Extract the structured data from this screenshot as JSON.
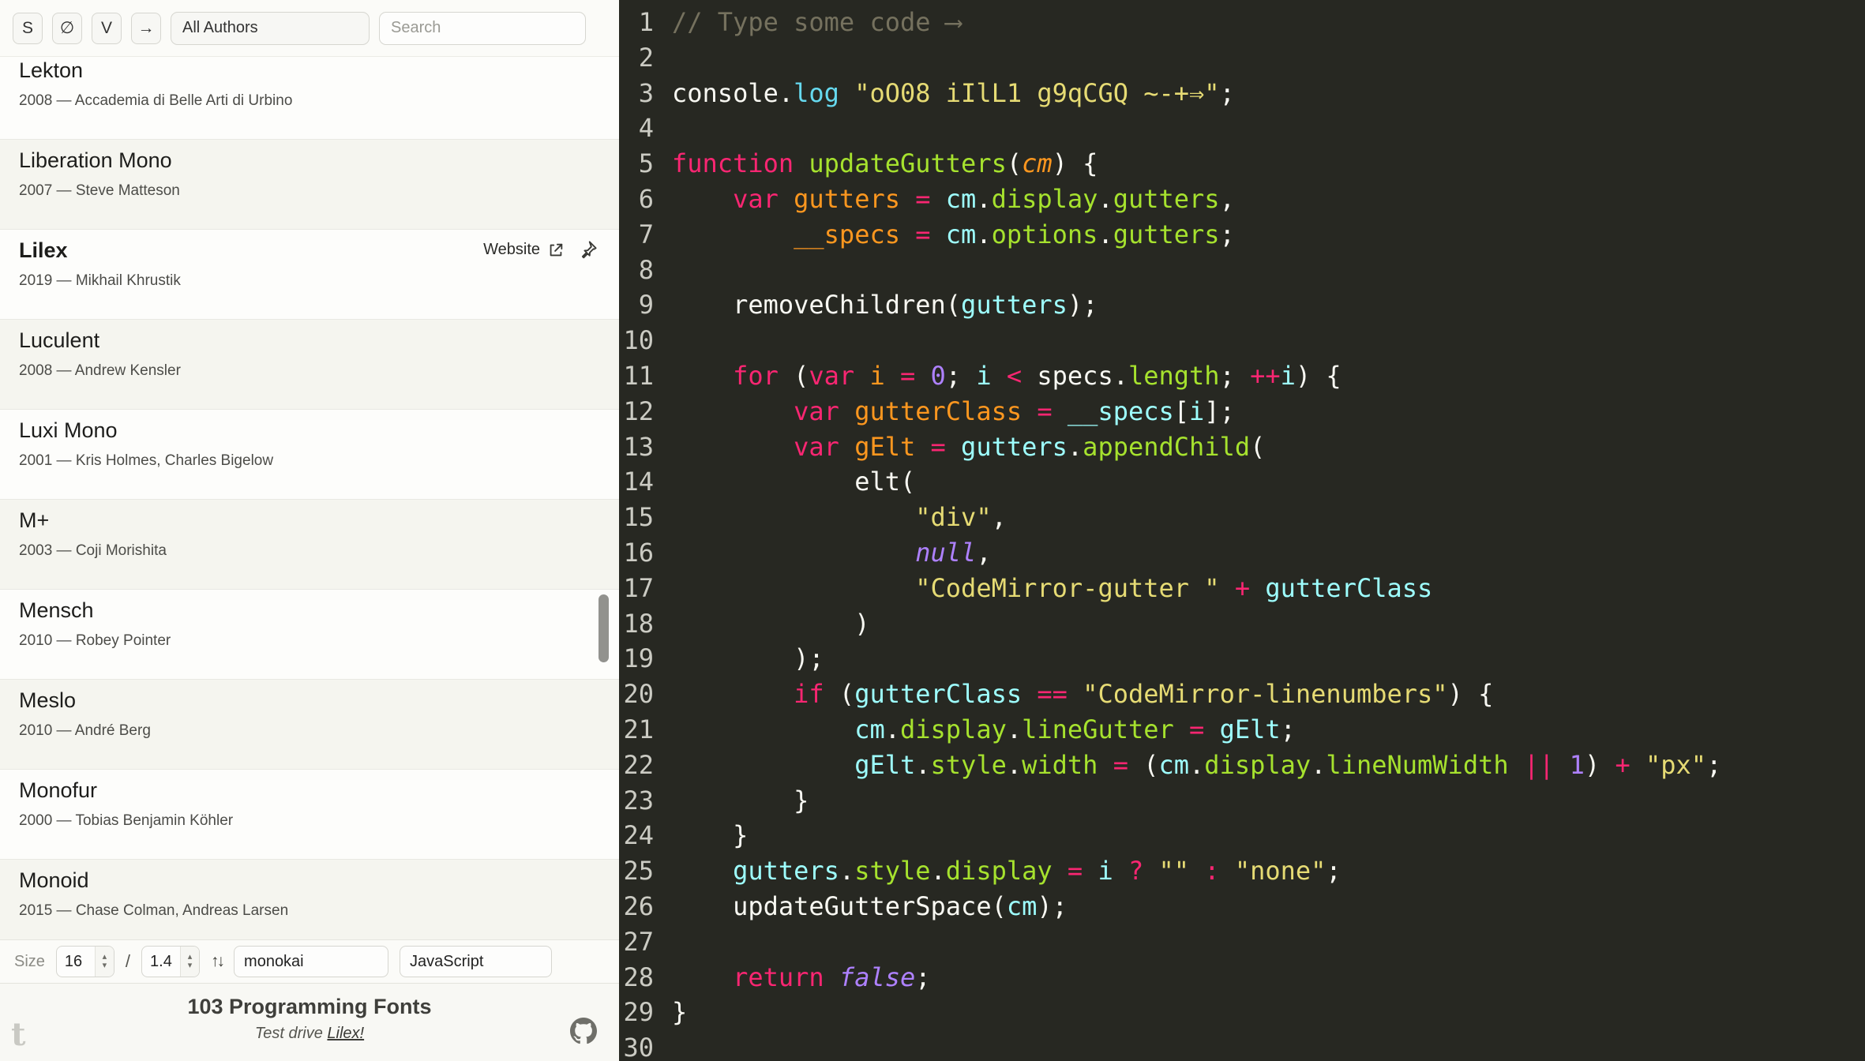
{
  "sidebar": {
    "toolbar": {
      "style_toggles": [
        "S",
        "∅",
        "V",
        "→"
      ],
      "author_filter_value": "All Authors",
      "search_placeholder": "Search"
    },
    "fonts": [
      {
        "name": "Lekton",
        "year": "2008",
        "author": "Accademia di Belle Arti di Urbino"
      },
      {
        "name": "Liberation Mono",
        "year": "2007",
        "author": "Steve Matteson"
      },
      {
        "name": "Lilex",
        "year": "2019",
        "author": "Mikhail Khrustik",
        "selected": true,
        "website_label": "Website"
      },
      {
        "name": "Luculent",
        "year": "2008",
        "author": "Andrew Kensler"
      },
      {
        "name": "Luxi Mono",
        "year": "2001",
        "author": "Kris Holmes, Charles Bigelow"
      },
      {
        "name": "M+",
        "year": "2003",
        "author": "Coji Morishita"
      },
      {
        "name": "Mensch",
        "year": "2010",
        "author": "Robey Pointer"
      },
      {
        "name": "Meslo",
        "year": "2010",
        "author": "André Berg"
      },
      {
        "name": "Monofur",
        "year": "2000",
        "author": "Tobias Benjamin Köhler"
      },
      {
        "name": "Monoid",
        "year": "2015",
        "author": "Chase Colman, Andreas Larsen"
      }
    ],
    "controls": {
      "size_label": "Size",
      "size_value": "16",
      "separator": "/",
      "line_height_value": "1.4",
      "sort_icon": "↑↓",
      "theme_value": "monokai",
      "language_value": "JavaScript"
    },
    "footer": {
      "count_title": "103 Programming Fonts",
      "tagline_prefix": "Test drive ",
      "tagline_link": "Lilex!",
      "t_logo": "t"
    },
    "ui_colors": {
      "stripe": "#f5f5ef",
      "border": "#e9e9e3",
      "background": "#fdfdfb"
    }
  },
  "editor": {
    "palette": {
      "background": "#272822",
      "lineNumber": "#cbcbc3",
      "w": "#f8f8f2",
      "k": "#f92672",
      "s": "#e6db74",
      "c": "#75715e",
      "n": "#ae81ff",
      "ni": "#ae81ff",
      "d": "#fd971f",
      "di": "#fd971f",
      "g": "#a6e22e",
      "b": "#66d9ef",
      "v2": "#9effff"
    },
    "lines": [
      [
        [
          "// Type some code ⟶",
          "c"
        ]
      ],
      [],
      [
        [
          "console",
          "w"
        ],
        [
          ".",
          "w"
        ],
        [
          "log",
          "b"
        ],
        [
          " ",
          "w"
        ],
        [
          "\"oO08 iIlL1 g9qCGQ ~-+⇒\"",
          "s"
        ],
        [
          ";",
          "w"
        ]
      ],
      [],
      [
        [
          "function",
          "k"
        ],
        [
          " ",
          "w"
        ],
        [
          "updateGutters",
          "g"
        ],
        [
          "(",
          "w"
        ],
        [
          "cm",
          "di"
        ],
        [
          ") {",
          "w"
        ]
      ],
      [
        [
          "    ",
          "w"
        ],
        [
          "var",
          "k"
        ],
        [
          " ",
          "w"
        ],
        [
          "gutters",
          "d"
        ],
        [
          " ",
          "w"
        ],
        [
          "=",
          "k"
        ],
        [
          " ",
          "w"
        ],
        [
          "cm",
          "v2"
        ],
        [
          ".",
          "w"
        ],
        [
          "display",
          "g"
        ],
        [
          ".",
          "w"
        ],
        [
          "gutters",
          "g"
        ],
        [
          ",",
          "w"
        ]
      ],
      [
        [
          "        ",
          "w"
        ],
        [
          "__specs",
          "d"
        ],
        [
          " ",
          "w"
        ],
        [
          "=",
          "k"
        ],
        [
          " ",
          "w"
        ],
        [
          "cm",
          "v2"
        ],
        [
          ".",
          "w"
        ],
        [
          "options",
          "g"
        ],
        [
          ".",
          "w"
        ],
        [
          "gutters",
          "g"
        ],
        [
          ";",
          "w"
        ]
      ],
      [],
      [
        [
          "    ",
          "w"
        ],
        [
          "removeChildren",
          "w"
        ],
        [
          "(",
          "w"
        ],
        [
          "gutters",
          "v2"
        ],
        [
          ");",
          "w"
        ]
      ],
      [],
      [
        [
          "    ",
          "w"
        ],
        [
          "for",
          "k"
        ],
        [
          " (",
          "w"
        ],
        [
          "var",
          "k"
        ],
        [
          " ",
          "w"
        ],
        [
          "i",
          "d"
        ],
        [
          " ",
          "w"
        ],
        [
          "=",
          "k"
        ],
        [
          " ",
          "w"
        ],
        [
          "0",
          "n"
        ],
        [
          "; ",
          "w"
        ],
        [
          "i",
          "v2"
        ],
        [
          " ",
          "w"
        ],
        [
          "<",
          "k"
        ],
        [
          " ",
          "w"
        ],
        [
          "specs",
          "w"
        ],
        [
          ".",
          "w"
        ],
        [
          "length",
          "g"
        ],
        [
          "; ",
          "w"
        ],
        [
          "++",
          "k"
        ],
        [
          "i",
          "v2"
        ],
        [
          ") {",
          "w"
        ]
      ],
      [
        [
          "        ",
          "w"
        ],
        [
          "var",
          "k"
        ],
        [
          " ",
          "w"
        ],
        [
          "gutterClass",
          "d"
        ],
        [
          " ",
          "w"
        ],
        [
          "=",
          "k"
        ],
        [
          " ",
          "w"
        ],
        [
          "__specs",
          "v2"
        ],
        [
          "[",
          "w"
        ],
        [
          "i",
          "v2"
        ],
        [
          "];",
          "w"
        ]
      ],
      [
        [
          "        ",
          "w"
        ],
        [
          "var",
          "k"
        ],
        [
          " ",
          "w"
        ],
        [
          "gElt",
          "d"
        ],
        [
          " ",
          "w"
        ],
        [
          "=",
          "k"
        ],
        [
          " ",
          "w"
        ],
        [
          "gutters",
          "v2"
        ],
        [
          ".",
          "w"
        ],
        [
          "appendChild",
          "g"
        ],
        [
          "(",
          "w"
        ]
      ],
      [
        [
          "            ",
          "w"
        ],
        [
          "elt",
          "w"
        ],
        [
          "(",
          "w"
        ]
      ],
      [
        [
          "                ",
          "w"
        ],
        [
          "\"div\"",
          "s"
        ],
        [
          ",",
          "w"
        ]
      ],
      [
        [
          "                ",
          "w"
        ],
        [
          "null",
          "ni"
        ],
        [
          ",",
          "w"
        ]
      ],
      [
        [
          "                ",
          "w"
        ],
        [
          "\"CodeMirror-gutter \"",
          "s"
        ],
        [
          " ",
          "w"
        ],
        [
          "+",
          "k"
        ],
        [
          " ",
          "w"
        ],
        [
          "gutterClass",
          "v2"
        ]
      ],
      [
        [
          "            )",
          "w"
        ]
      ],
      [
        [
          "        );",
          "w"
        ]
      ],
      [
        [
          "        ",
          "w"
        ],
        [
          "if",
          "k"
        ],
        [
          " (",
          "w"
        ],
        [
          "gutterClass",
          "v2"
        ],
        [
          " ",
          "w"
        ],
        [
          "==",
          "k"
        ],
        [
          " ",
          "w"
        ],
        [
          "\"CodeMirror-linenumbers\"",
          "s"
        ],
        [
          ") {",
          "w"
        ]
      ],
      [
        [
          "            ",
          "w"
        ],
        [
          "cm",
          "v2"
        ],
        [
          ".",
          "w"
        ],
        [
          "display",
          "g"
        ],
        [
          ".",
          "w"
        ],
        [
          "lineGutter",
          "g"
        ],
        [
          " ",
          "w"
        ],
        [
          "=",
          "k"
        ],
        [
          " ",
          "w"
        ],
        [
          "gElt",
          "v2"
        ],
        [
          ";",
          "w"
        ]
      ],
      [
        [
          "            ",
          "w"
        ],
        [
          "gElt",
          "v2"
        ],
        [
          ".",
          "w"
        ],
        [
          "style",
          "g"
        ],
        [
          ".",
          "w"
        ],
        [
          "width",
          "g"
        ],
        [
          " ",
          "w"
        ],
        [
          "=",
          "k"
        ],
        [
          " (",
          "w"
        ],
        [
          "cm",
          "v2"
        ],
        [
          ".",
          "w"
        ],
        [
          "display",
          "g"
        ],
        [
          ".",
          "w"
        ],
        [
          "lineNumWidth",
          "g"
        ],
        [
          " ",
          "w"
        ],
        [
          "||",
          "k"
        ],
        [
          " ",
          "w"
        ],
        [
          "1",
          "n"
        ],
        [
          ") ",
          "w"
        ],
        [
          "+",
          "k"
        ],
        [
          " ",
          "w"
        ],
        [
          "\"px\"",
          "s"
        ],
        [
          ";",
          "w"
        ]
      ],
      [
        [
          "        }",
          "w"
        ]
      ],
      [
        [
          "    }",
          "w"
        ]
      ],
      [
        [
          "    ",
          "w"
        ],
        [
          "gutters",
          "v2"
        ],
        [
          ".",
          "w"
        ],
        [
          "style",
          "g"
        ],
        [
          ".",
          "w"
        ],
        [
          "display",
          "g"
        ],
        [
          " ",
          "w"
        ],
        [
          "=",
          "k"
        ],
        [
          " ",
          "w"
        ],
        [
          "i",
          "v2"
        ],
        [
          " ",
          "w"
        ],
        [
          "?",
          "k"
        ],
        [
          " ",
          "w"
        ],
        [
          "\"\"",
          "s"
        ],
        [
          " ",
          "w"
        ],
        [
          ":",
          "k"
        ],
        [
          " ",
          "w"
        ],
        [
          "\"none\"",
          "s"
        ],
        [
          ";",
          "w"
        ]
      ],
      [
        [
          "    ",
          "w"
        ],
        [
          "updateGutterSpace",
          "w"
        ],
        [
          "(",
          "w"
        ],
        [
          "cm",
          "v2"
        ],
        [
          ");",
          "w"
        ]
      ],
      [],
      [
        [
          "    ",
          "w"
        ],
        [
          "return",
          "k"
        ],
        [
          " ",
          "w"
        ],
        [
          "false",
          "ni"
        ],
        [
          ";",
          "w"
        ]
      ],
      [
        [
          "}",
          "w"
        ]
      ],
      []
    ]
  }
}
